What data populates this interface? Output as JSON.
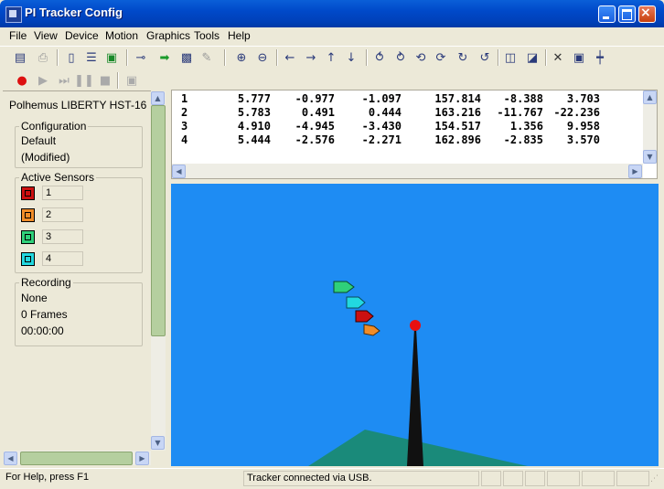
{
  "window": {
    "title": "PI Tracker Config"
  },
  "menu": [
    "File",
    "View",
    "Device",
    "Motion",
    "Graphics",
    "Tools",
    "Help"
  ],
  "left_panel": {
    "device": "Polhemus LIBERTY HST-16",
    "configuration": {
      "title": "Configuration",
      "name": "Default",
      "state": "(Modified)"
    },
    "active_sensors": {
      "title": "Active Sensors",
      "sensors": [
        {
          "label": "1",
          "color": "#cc1010"
        },
        {
          "label": "2",
          "color": "#f08c28"
        },
        {
          "label": "3",
          "color": "#2fd07a"
        },
        {
          "label": "4",
          "color": "#22d8e0"
        }
      ]
    },
    "recording": {
      "title": "Recording",
      "status": "None",
      "frames": "0 Frames",
      "time": "00:00:00"
    }
  },
  "readout": {
    "rows": [
      [
        "1",
        "5.777",
        "-0.977",
        "-1.097",
        "157.814",
        "-8.388",
        "3.703"
      ],
      [
        "2",
        "5.783",
        "0.491",
        "0.444",
        "163.216",
        "-11.767",
        "-22.236"
      ],
      [
        "3",
        "4.910",
        "-4.945",
        "-3.430",
        "154.517",
        "1.356",
        "9.958"
      ],
      [
        "4",
        "5.444",
        "-2.576",
        "-2.271",
        "162.896",
        "-2.835",
        "3.570"
      ]
    ]
  },
  "viewport": {
    "background": "#1e8cf3",
    "floor_color": "#1a8a7a",
    "source_color": "#111111",
    "marker_color": "#e81010"
  },
  "status_bar": {
    "help": "For Help, press F1",
    "connection": "Tracker connected via USB."
  }
}
